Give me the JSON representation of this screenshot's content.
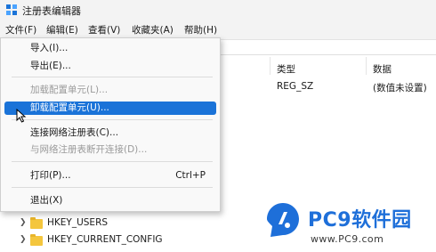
{
  "window": {
    "title": "注册表编辑器"
  },
  "menubar": [
    "文件(F)",
    "编辑(E)",
    "查看(V)",
    "收藏夹(A)",
    "帮助(H)"
  ],
  "columns": {
    "type": "类型",
    "data": "数据"
  },
  "default_value": {
    "type": "REG_SZ",
    "data": "(数值未设置)"
  },
  "tree": [
    {
      "label": "HKEY_USERS"
    },
    {
      "label": "HKEY_CURRENT_CONFIG"
    }
  ],
  "file_menu": {
    "items": [
      {
        "label": "导入(I)...",
        "disabled": false
      },
      {
        "label": "导出(E)...",
        "disabled": false
      },
      {
        "label": "加载配置单元(L)...",
        "disabled": true
      },
      {
        "label": "卸载配置单元(U)...",
        "disabled": false,
        "selected": true
      },
      {
        "label": "连接网络注册表(C)...",
        "disabled": false
      },
      {
        "label": "与网络注册表断开连接(D)...",
        "disabled": true
      },
      {
        "label": "打印(P)...",
        "disabled": false,
        "shortcut": "Ctrl+P"
      },
      {
        "label": "退出(X)",
        "disabled": false
      }
    ]
  },
  "watermark": {
    "brand": "PC9软件园",
    "url": "www.PC9.com",
    "color": "#1e6fd9"
  },
  "colors": {
    "selection": "#1a73d8",
    "folder": "#f4c63d"
  }
}
